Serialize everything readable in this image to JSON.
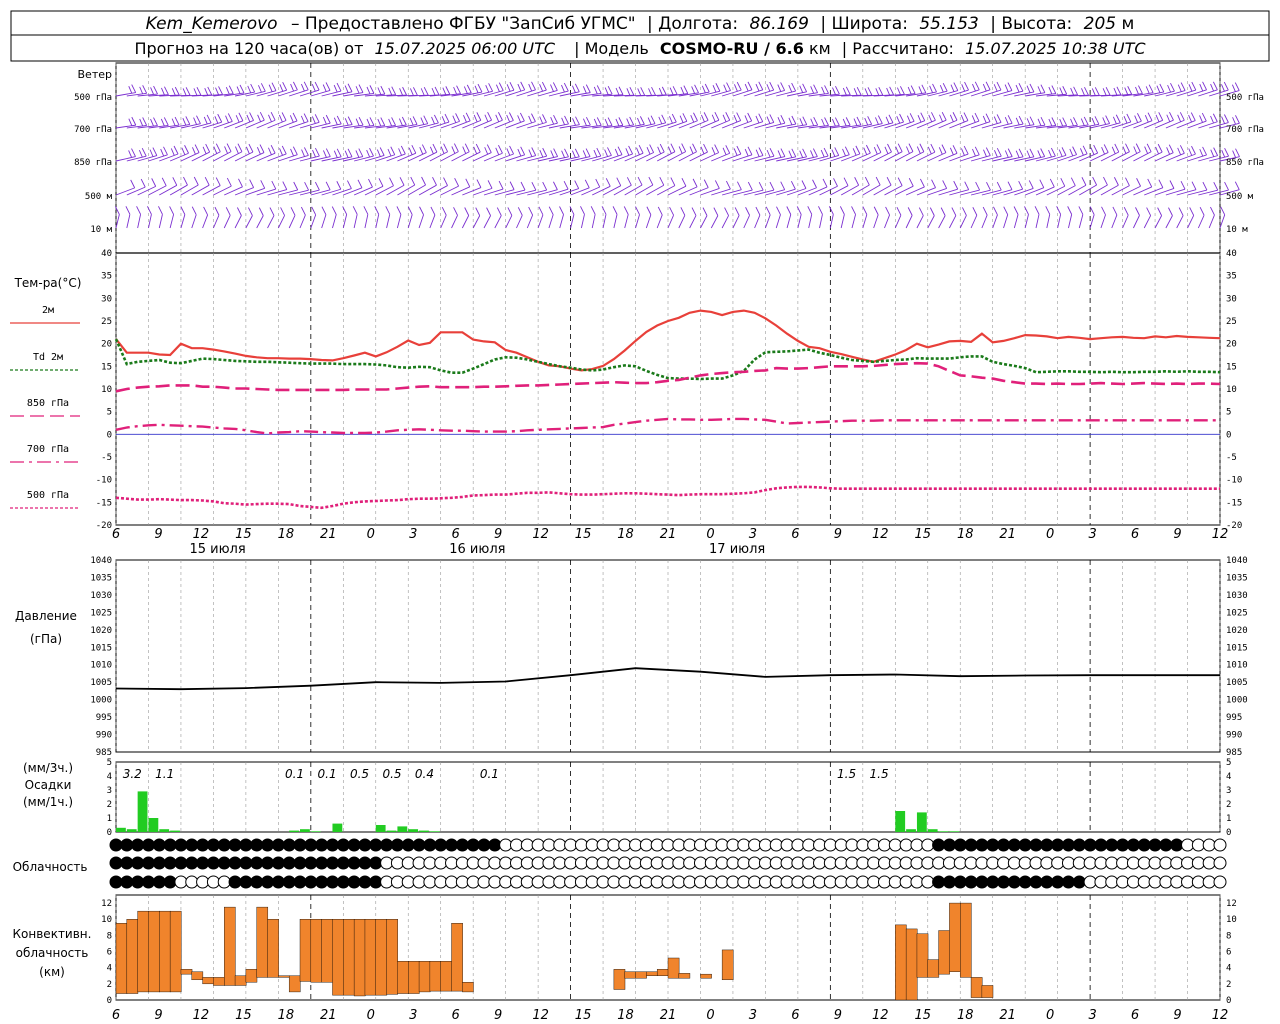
{
  "header": {
    "line1": {
      "station": "Kem_Kemerovo",
      "provided_by": "– Предоставлено ФГБУ \"ЗапСиб УГМС\"",
      "lon_label": "| Долгота:",
      "lon": "86.169",
      "lat_label": "| Широта:",
      "lat": "55.153",
      "alt_label": "| Высота:",
      "alt": "205",
      "alt_unit": "м"
    },
    "line2": {
      "forecast_label": "Прогноз на 120 часа(ов) от",
      "start": "15.07.2025 06:00 UTC",
      "model_label": "| Модель",
      "model": "COSMO-RU / 6.6",
      "model_unit": "км",
      "calc_label": "| Рассчитано:",
      "calc": "15.07.2025 10:38 UTC"
    }
  },
  "wind_panel": {
    "title": "Ветер",
    "levels": [
      "500 гПа",
      "700 гПа",
      "850 гПа",
      "500 м",
      "10  м"
    ],
    "colors": [
      "#7b2fd0",
      "#7b2fd0",
      "#7b2fd0",
      "#7b2fd0",
      "#7b2fd0"
    ]
  },
  "temp_panel": {
    "title": "Тем-ра(°С)",
    "legend": [
      {
        "label": "2м",
        "color": "#e8403a",
        "style": "solid"
      },
      {
        "label": "Td  2м",
        "color": "#1a7a1a",
        "style": "dotted"
      },
      {
        "label": "850 гПа",
        "color": "#e0207a",
        "style": "dashed"
      },
      {
        "label": "700 гПа",
        "color": "#e0207a",
        "style": "dashdot"
      },
      {
        "label": "500 гПа",
        "color": "#e0207a",
        "style": "dotted"
      }
    ],
    "yticks": [
      "40",
      "35",
      "30",
      "25",
      "20",
      "15",
      "10",
      "5",
      "0",
      "-5",
      "-10",
      "-15",
      "-20"
    ]
  },
  "x_axis": {
    "ticks": [
      "6",
      "9",
      "12",
      "15",
      "18",
      "21",
      "0",
      "3",
      "6",
      "9",
      "12",
      "15",
      "18",
      "21",
      "0",
      "3",
      "6",
      "9",
      "12",
      "15",
      "18",
      "21",
      "0",
      "3",
      "6",
      "9",
      "12"
    ],
    "days": [
      "15 июля",
      "16 июля",
      "17 июля"
    ]
  },
  "pressure_panel": {
    "title": "Давление",
    "unit": "(гПа)",
    "yticks": [
      "1040",
      "1035",
      "1030",
      "1025",
      "1020",
      "1015",
      "1010",
      "1005",
      "1000",
      "995",
      "990",
      "985"
    ]
  },
  "precip_panel": {
    "title_top": "(мм/3ч.)",
    "title": "Осадки",
    "unit": "(мм/1ч.)",
    "yticks": [
      "5",
      "4",
      "3",
      "2",
      "1",
      "0"
    ],
    "totals": [
      {
        "hour": 9,
        "label": "3.2"
      },
      {
        "hour": 12,
        "label": "1.1"
      },
      {
        "hour": 24,
        "label": "0.1"
      },
      {
        "hour": 27,
        "label": "0.1"
      },
      {
        "hour": 30,
        "label": "0.5"
      },
      {
        "hour": 33,
        "label": "0.5"
      },
      {
        "hour": 36,
        "label": "0.4"
      },
      {
        "hour": 42,
        "label": "0.1"
      },
      {
        "hour": 75,
        "label": "1.5"
      },
      {
        "hour": 78,
        "label": "1.5"
      }
    ]
  },
  "cloud_panel": {
    "title": "Облачность"
  },
  "conv_panel": {
    "title_lines": [
      "Конвективн.",
      "облачность",
      "(км)"
    ],
    "yticks": [
      "12",
      "10",
      "8",
      "6",
      "4",
      "2",
      "0"
    ]
  },
  "colors": {
    "t2m": "#e8403a",
    "td2m": "#1a7a1a",
    "upper": "#e0207a",
    "wind": "#7b2fd0",
    "pressure": "#000000",
    "precip": "#22cc22",
    "conv": "#f0842c",
    "zero_line": "#3333cc"
  },
  "chart_data": [
    {
      "type": "line",
      "name": "temperature",
      "hours": [
        0,
        1,
        2,
        3,
        4,
        5,
        6,
        7,
        8,
        9,
        10,
        11,
        12,
        13,
        14,
        15,
        16,
        17,
        18,
        19,
        20,
        21,
        22,
        23,
        24,
        25,
        26,
        27,
        28,
        29,
        30,
        31,
        32,
        33,
        34,
        35,
        36,
        37,
        38,
        39,
        40,
        41,
        42,
        43,
        44,
        45,
        46,
        47,
        48,
        49,
        50,
        51,
        52,
        53,
        54,
        55,
        56,
        57,
        58,
        59,
        60,
        61,
        62,
        63,
        64,
        65,
        66,
        67,
        68,
        69,
        70,
        71,
        72,
        73,
        74,
        75,
        76,
        77,
        78,
        79,
        80,
        81,
        82,
        83,
        84,
        85,
        86,
        87,
        88,
        89,
        90,
        91,
        92,
        93,
        94,
        95,
        96,
        97,
        98,
        99,
        100,
        101,
        102
      ],
      "series": [
        {
          "name": "2м",
          "values": [
            21,
            18,
            18,
            18,
            17.6,
            17.5,
            20,
            19,
            19,
            18.7,
            18.3,
            17.8,
            17.3,
            17,
            16.8,
            16.8,
            16.7,
            16.7,
            16.6,
            16.4,
            16.3,
            16.8,
            17.4,
            18,
            17.2,
            18.1,
            19.3,
            20.7,
            19.7,
            20.2,
            22.5,
            22.5,
            22.5,
            20.9,
            20.5,
            20.3,
            18.6,
            18,
            17,
            16,
            15.2,
            15,
            14.5,
            14.1,
            14.4,
            15.1,
            16.6,
            18.5,
            20.6,
            22.6,
            24,
            25,
            25.7,
            26.8,
            27.3,
            27,
            26.3,
            27,
            27.3,
            26.8,
            25.6,
            24,
            22.2,
            20.6,
            19.3,
            19,
            18.2,
            17.7,
            17.1,
            16.5,
            16,
            16.8,
            17.6,
            18.6,
            20,
            19.2,
            19.8,
            20.5,
            20.6,
            20.4,
            22.2,
            20.3,
            20.6,
            21.2,
            21.9,
            21.8,
            21.6,
            21.2,
            21.5,
            21.3,
            21,
            21.2,
            21.4,
            21.5,
            21.3,
            21.2,
            21.6,
            21.4,
            21.7,
            21.5,
            21.4,
            21.3,
            21.2
          ]
        },
        {
          "name": "Td 2м",
          "values": [
            21,
            15.5,
            16,
            16.2,
            16.4,
            15.8,
            15.7,
            16.2,
            16.7,
            16.6,
            16.4,
            16.2,
            16.1,
            16,
            16,
            15.9,
            15.8,
            15.7,
            15.6,
            15.6,
            15.6,
            15.5,
            15.5,
            15.5,
            15.4,
            15.2,
            14.8,
            14.7,
            14.9,
            14.8,
            14.1,
            13.6,
            13.6,
            14.5,
            15.5,
            16.5,
            17,
            16.9,
            16.5,
            16,
            15.5,
            15,
            14.7,
            14.3,
            14.1,
            14.3,
            14.8,
            15.2,
            15,
            14,
            13.1,
            12.4,
            12.3,
            12.3,
            12.2,
            12.3,
            12.3,
            13,
            14,
            16.5,
            18.1,
            18.2,
            18.3,
            18.5,
            18.7,
            18,
            17.5,
            16.9,
            16.4,
            16.2,
            16,
            16.2,
            16.4,
            16.5,
            16.8,
            16.7,
            16.7,
            16.7,
            17,
            17.2,
            17.2,
            16,
            15.5,
            15.1,
            14.6,
            13.7,
            13.8,
            13.9,
            13.9,
            13.8,
            13.8,
            13.7,
            13.8,
            13.7,
            13.7,
            13.8,
            13.8,
            13.9,
            13.8,
            13.9,
            13.8,
            13.8,
            13.7
          ]
        },
        {
          "name": "850 гПа",
          "values": [
            9.5,
            10,
            10.3,
            10.5,
            10.6,
            10.8,
            10.8,
            10.8,
            10.5,
            10.5,
            10.3,
            10.1,
            10.1,
            10,
            9.9,
            9.8,
            9.8,
            9.8,
            9.8,
            9.8,
            9.8,
            9.8,
            9.9,
            9.9,
            9.9,
            9.9,
            10.1,
            10.3,
            10.5,
            10.6,
            10.4,
            10.4,
            10.4,
            10.4,
            10.5,
            10.5,
            10.6,
            10.7,
            10.8,
            10.8,
            10.9,
            11,
            11.1,
            11.2,
            11.3,
            11.4,
            11.5,
            11.4,
            11.3,
            11.3,
            11.5,
            11.8,
            12,
            12.5,
            13,
            13.3,
            13.5,
            13.7,
            13.8,
            14,
            14.1,
            14.6,
            14.5,
            14.5,
            14.6,
            14.8,
            15,
            15,
            15,
            15,
            15.1,
            15.3,
            15.5,
            15.6,
            15.7,
            15.6,
            15,
            14,
            13,
            12.8,
            12.5,
            12.3,
            11.8,
            11.5,
            11.2,
            11.2,
            11.1,
            11.2,
            11.1,
            11.1,
            11.2,
            11.3,
            11.2,
            11.1,
            11.2,
            11.3,
            11.2,
            11.1,
            11.2,
            11.1,
            11.2,
            11.2,
            11.1
          ]
        },
        {
          "name": "700 гПа",
          "values": [
            1,
            1.5,
            1.8,
            2,
            2.1,
            2,
            1.9,
            1.8,
            1.7,
            1.5,
            1.3,
            1.2,
            0.9,
            0.5,
            0.2,
            0.4,
            0.5,
            0.7,
            0.6,
            0.5,
            0.4,
            0.3,
            0.3,
            0.3,
            0.4,
            0.6,
            0.9,
            1,
            1.1,
            1,
            0.9,
            0.8,
            0.8,
            0.7,
            0.6,
            0.6,
            0.6,
            0.7,
            0.9,
            1,
            1.1,
            1.2,
            1.3,
            1.4,
            1.5,
            1.6,
            2.1,
            2.4,
            2.7,
            3,
            3.2,
            3.4,
            3.3,
            3.3,
            3.2,
            3.2,
            3.3,
            3.4,
            3.4,
            3.3,
            3.2,
            2.8,
            2.4,
            2.5,
            2.6,
            2.7,
            2.8,
            2.9,
            3,
            3,
            3,
            3.1,
            3.1,
            3.1,
            3.1,
            3.1,
            3.1,
            3.1,
            3.1,
            3.1,
            3.1,
            3.1,
            3.1,
            3.1,
            3.1,
            3.1,
            3.1,
            3.1,
            3.1,
            3.1,
            3.1,
            3.1,
            3.1,
            3.1,
            3.1,
            3.1,
            3.1,
            3.1,
            3.1,
            3.1,
            3.1,
            3.1,
            3.1
          ]
        },
        {
          "name": "500 гПа",
          "values": [
            -14,
            -14.2,
            -14.4,
            -14.4,
            -14.3,
            -14.4,
            -14.5,
            -14.5,
            -14.6,
            -14.8,
            -15.2,
            -15.3,
            -15.5,
            -15.4,
            -15.3,
            -15.3,
            -15.4,
            -15.8,
            -16,
            -16.2,
            -15.8,
            -15.3,
            -15,
            -14.8,
            -14.7,
            -14.6,
            -14.5,
            -14.3,
            -14.2,
            -14.2,
            -14.1,
            -14,
            -13.8,
            -13.5,
            -13.4,
            -13.3,
            -13.3,
            -13.1,
            -12.9,
            -12.9,
            -12.8,
            -13,
            -13.2,
            -13.3,
            -13.3,
            -13.2,
            -13.1,
            -13,
            -13,
            -13.1,
            -13.2,
            -13.3,
            -13.4,
            -13.3,
            -13.2,
            -13.2,
            -13.2,
            -13.1,
            -13,
            -12.8,
            -12.3,
            -11.9,
            -11.7,
            -11.6,
            -11.6,
            -11.7,
            -11.9,
            -12,
            -12,
            -12,
            -12,
            -12,
            -12,
            -12,
            -12,
            -12,
            -12,
            -12,
            -12,
            -12,
            -12,
            -12,
            -12,
            -12,
            -12,
            -12,
            -12,
            -12,
            -12,
            -12,
            -12,
            -12,
            -12,
            -12,
            -12,
            -12,
            -12,
            -12,
            -12,
            -12,
            -12,
            -12,
            -12,
            -12
          ]
        }
      ],
      "ylim": [
        -20,
        40
      ]
    },
    {
      "type": "line",
      "name": "pressure",
      "hours": [
        0,
        6,
        12,
        18,
        24,
        30,
        36,
        42,
        48,
        54,
        60,
        66,
        72,
        78,
        84,
        90,
        96,
        102
      ],
      "series": [
        {
          "name": "pressure",
          "values": [
            1003.2,
            1003,
            1003.3,
            1004,
            1005,
            1004.8,
            1005.2,
            1007,
            1009,
            1008,
            1006.5,
            1007,
            1007.2,
            1006.7,
            1006.9,
            1007,
            1007,
            1007
          ]
        }
      ],
      "ylim": [
        985,
        1040
      ]
    },
    {
      "type": "bar",
      "name": "precipitation",
      "hours": [
        0,
        1,
        2,
        3,
        4,
        5,
        16,
        17,
        18,
        20,
        24,
        25,
        26,
        27,
        28,
        29,
        72,
        73,
        74,
        75,
        76,
        77
      ],
      "values": [
        0.3,
        0.2,
        2.9,
        1.0,
        0.2,
        0.1,
        0.1,
        0.2,
        0.05,
        0.6,
        0.5,
        0.1,
        0.4,
        0.2,
        0.1,
        0.05,
        1.5,
        0.2,
        1.4,
        0.2,
        0.05,
        0.05
      ],
      "ylim": [
        0,
        5
      ]
    },
    {
      "type": "bar",
      "name": "convective_cloud",
      "hours": [
        0,
        1,
        2,
        3,
        4,
        5,
        6,
        7,
        8,
        9,
        10,
        11,
        12,
        13,
        14,
        15,
        16,
        17,
        18,
        19,
        20,
        21,
        22,
        23,
        24,
        25,
        26,
        27,
        28,
        29,
        30,
        31,
        32,
        33,
        34,
        35,
        36,
        37,
        38,
        39,
        40,
        41,
        42,
        43,
        44,
        45,
        46,
        47,
        48,
        49,
        50,
        51,
        52,
        53,
        54,
        55,
        56,
        57,
        58,
        59,
        60,
        61,
        62,
        63,
        64,
        65,
        66,
        67,
        68,
        69,
        70,
        71,
        72,
        73,
        74,
        75,
        76,
        77,
        78,
        79,
        80,
        81,
        82,
        83
      ],
      "bases": [
        0.8,
        0.8,
        1.0,
        1.0,
        1.0,
        1.0,
        3.2,
        2.5,
        2.0,
        1.8,
        1.8,
        1.8,
        2.2,
        2.8,
        2.8,
        2.8,
        1.0,
        2.3,
        2.2,
        2.2,
        0.6,
        0.6,
        0.5,
        0.6,
        0.6,
        0.7,
        0.8,
        0.8,
        1.0,
        1.1,
        1.1,
        1.1,
        1.0,
        1.1,
        1.8,
        2.0,
        1.8,
        0,
        0,
        0,
        0,
        0,
        0,
        0,
        0,
        0,
        1.3,
        2.7,
        2.7,
        3.0,
        3.0,
        2.7,
        2.7,
        2.7,
        2.7,
        2.7,
        2.5,
        2.5,
        0,
        0,
        0,
        0,
        0,
        0,
        0,
        0,
        0,
        0,
        0,
        0,
        0,
        0,
        0,
        0,
        2.8,
        2.8,
        3.2,
        3.5,
        2.8,
        0.3,
        0.3,
        0.3,
        2.2,
        1.2
      ],
      "tops": [
        9.5,
        10,
        11,
        11,
        11,
        11,
        3.8,
        3.5,
        2.8,
        2.8,
        11.5,
        3.0,
        3.8,
        11.5,
        10,
        3.0,
        3.0,
        10,
        10,
        10,
        10,
        10,
        10,
        10,
        10,
        10,
        4.8,
        4.8,
        4.8,
        4.8,
        4.8,
        9.5,
        2.2,
        0,
        0,
        0,
        0,
        0,
        0,
        0,
        0,
        0,
        0,
        0,
        0,
        0,
        3.8,
        3.5,
        3.5,
        3.5,
        3.8,
        5.2,
        3.3,
        0,
        3.2,
        2.5,
        6.2,
        0,
        0,
        0,
        0,
        0,
        0,
        0,
        0,
        0,
        0,
        0,
        0,
        0,
        0,
        0,
        9.3,
        8.8,
        8.2,
        5.0,
        8.6,
        12,
        12,
        2.8,
        1.8,
        0,
        0,
        0
      ],
      "ylim": [
        0,
        13
      ]
    }
  ]
}
